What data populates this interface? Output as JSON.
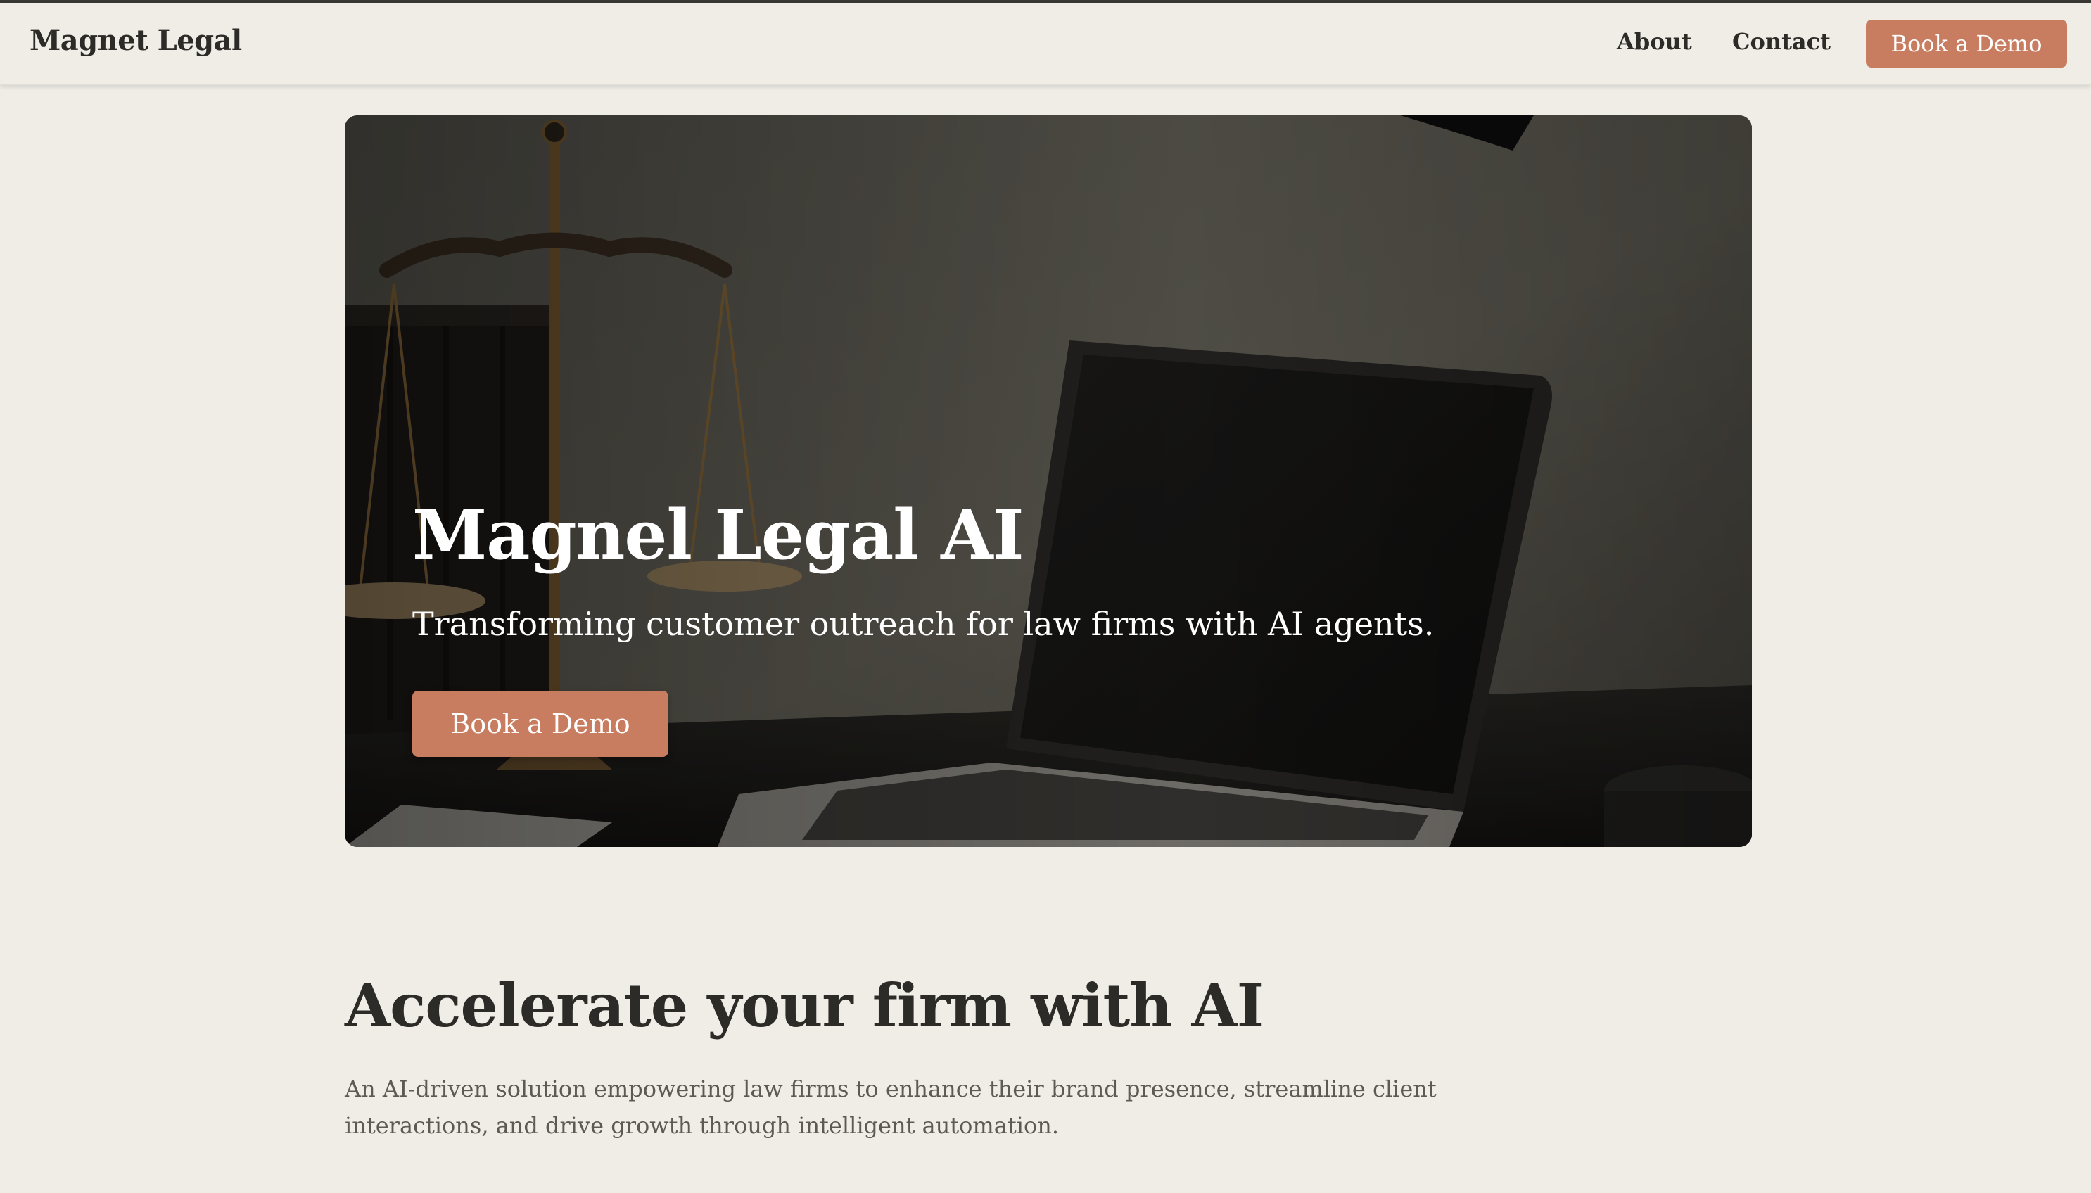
{
  "nav": {
    "brand": "Magnet Legal",
    "links": [
      "About",
      "Contact"
    ],
    "cta_label": "Book a Demo"
  },
  "hero": {
    "title": "Magnel Legal AI",
    "subtitle": "Transforming customer outreach for law firms with AI agents.",
    "cta_label": "Book a Demo",
    "image_description_icon": "scales-of-justice-and-laptop-image"
  },
  "section": {
    "title": "Accelerate your firm with AI",
    "body": "An AI-driven solution empowering law firms to enhance their brand presence, streamline client interactions, and drive growth through intelligent automation."
  },
  "colors": {
    "background": "#efede6",
    "accent": "#c97d60",
    "text": "#2d2b28",
    "muted_text": "#5d5a54"
  }
}
